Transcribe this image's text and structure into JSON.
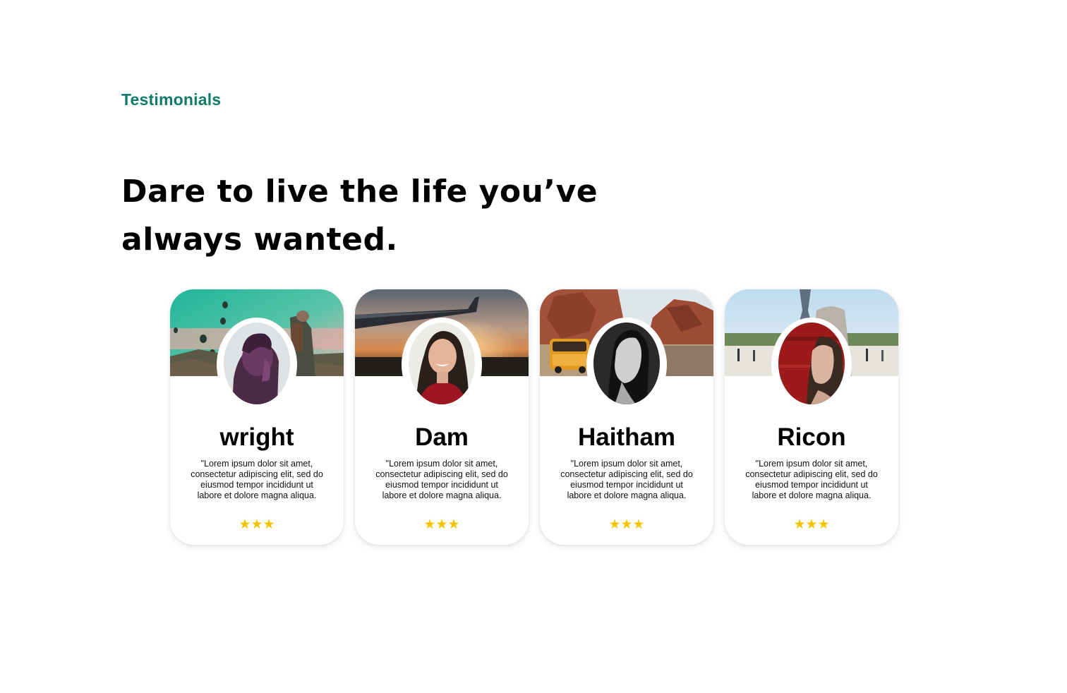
{
  "header": {
    "eyebrow": "Testimonials",
    "headline": "Dare to live the life you’ve always wanted."
  },
  "colors": {
    "accent": "#117A6C",
    "star": "#F5C400",
    "text": "#000000"
  },
  "testimonials": [
    {
      "name": "wright",
      "quote": "\"Lorem ipsum dolor sit amet, consectetur adipiscing elit, sed do eiusmod tempor incididunt ut labore et dolore magna aliqua.",
      "stars": "★★★",
      "rating": 3,
      "banner": "hot-air-balloons-photo",
      "avatar": "woman-purple-profile-photo"
    },
    {
      "name": "Dam",
      "quote": "\"Lorem ipsum dolor sit amet, consectetur adipiscing elit, sed do eiusmod tempor incididunt ut labore et dolore magna aliqua.",
      "stars": "★★★",
      "rating": 3,
      "banner": "airplane-wing-sunset-photo",
      "avatar": "smiling-woman-red-top-photo"
    },
    {
      "name": "Haitham",
      "quote": "\"Lorem ipsum dolor sit amet, consectetur adipiscing elit, sed do eiusmod tempor incididunt ut labore et dolore magna aliqua.",
      "stars": "★★★",
      "rating": 3,
      "banner": "desert-canyon-van-photo",
      "avatar": "woman-black-white-profile-photo"
    },
    {
      "name": "Ricon",
      "quote": "\"Lorem ipsum dolor sit amet, consectetur adipiscing elit, sed do eiusmod tempor incididunt ut labore et dolore magna aliqua.",
      "stars": "★★★",
      "rating": 3,
      "banner": "eiffel-tower-plaza-photo",
      "avatar": "woman-red-wall-profile-photo"
    }
  ]
}
